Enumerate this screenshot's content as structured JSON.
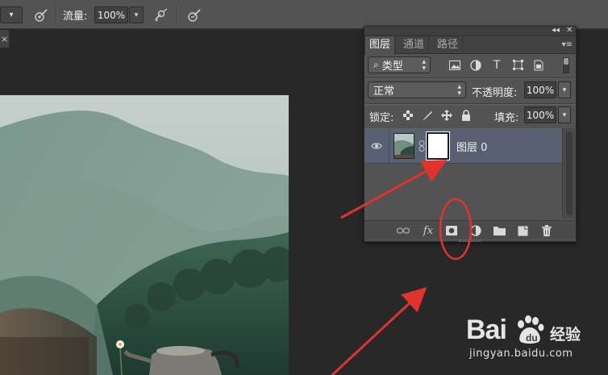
{
  "options_bar": {
    "flow_label": "流量:",
    "flow_value": "100%"
  },
  "document": {
    "tab_close": "×"
  },
  "layers_panel": {
    "collapse_glyph": "◂◂",
    "close_glyph": "✕",
    "tabs": [
      {
        "label": "图层",
        "active": true
      },
      {
        "label": "通道",
        "active": false
      },
      {
        "label": "路径",
        "active": false
      }
    ],
    "filter": {
      "type_label": "类型",
      "icons": [
        "image-filter-icon",
        "adjustment-filter-icon",
        "type-filter-icon",
        "shape-filter-icon",
        "smart-object-filter-icon"
      ]
    },
    "blend_mode": "正常",
    "opacity_label": "不透明度:",
    "opacity_value": "100%",
    "lock_label": "锁定:",
    "fill_label": "填充:",
    "fill_value": "100%",
    "layers": [
      {
        "name": "图层 0",
        "visible": true,
        "selected": true,
        "has_mask": true
      }
    ],
    "footer_buttons": [
      "link-layers-icon",
      "fx-icon",
      "add-mask-icon",
      "adjustment-layer-icon",
      "group-folder-icon",
      "new-layer-icon",
      "trash-icon"
    ]
  },
  "watermark": {
    "brand": "Bai",
    "suffix": "经验",
    "url": "jingyan.baidu.com"
  },
  "colors": {
    "panel_bg": "#535353",
    "selected_layer": "#586171",
    "annotation_red": "#e0332e"
  }
}
